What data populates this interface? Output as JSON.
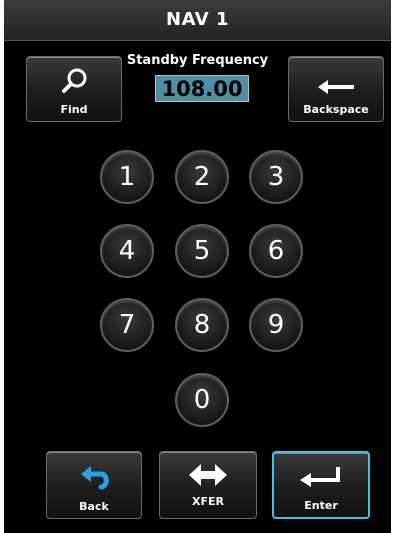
{
  "window": {
    "title": "NAV 1"
  },
  "frequency": {
    "label": "Standby Frequency",
    "value": "108.00"
  },
  "buttons": {
    "find": "Find",
    "backspace": "Backspace",
    "back": "Back",
    "xfer": "XFER",
    "enter": "Enter"
  },
  "keypad": [
    "1",
    "2",
    "3",
    "4",
    "5",
    "6",
    "7",
    "8",
    "9",
    "0"
  ],
  "colors": {
    "active_border": "#3cc3f0",
    "frequency_box": "#4f8fa3",
    "icon_blue": "#2c9fe6"
  }
}
